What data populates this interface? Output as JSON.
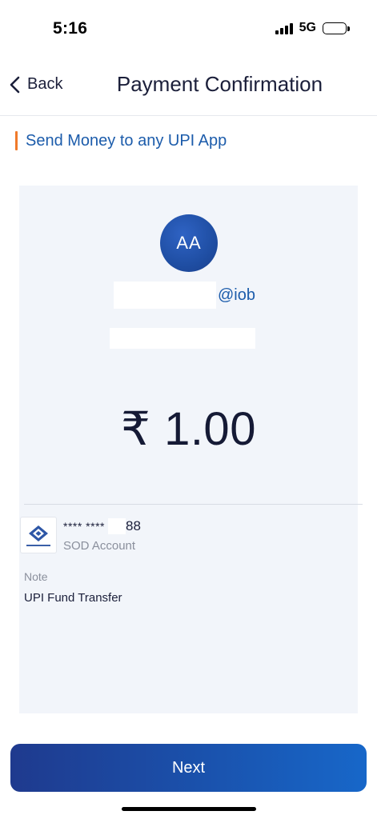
{
  "status_bar": {
    "time": "5:16",
    "network": "5G"
  },
  "header": {
    "back_label": "Back",
    "title": "Payment Confirmation"
  },
  "section": {
    "heading": "Send Money to any UPI App"
  },
  "payee": {
    "avatar_initials": "AA",
    "vpa_suffix": "@iob"
  },
  "amount": "₹ 1.00",
  "account": {
    "number_prefix": "**** ****",
    "number_suffix": "88",
    "type": "SOD Account"
  },
  "note": {
    "label": "Note",
    "value": "UPI Fund Transfer"
  },
  "actions": {
    "next_label": "Next"
  },
  "colors": {
    "accent": "#1c5cab",
    "heading_marker": "#f07a2a",
    "button_start": "#1f3a8e",
    "button_end": "#1767c9"
  }
}
